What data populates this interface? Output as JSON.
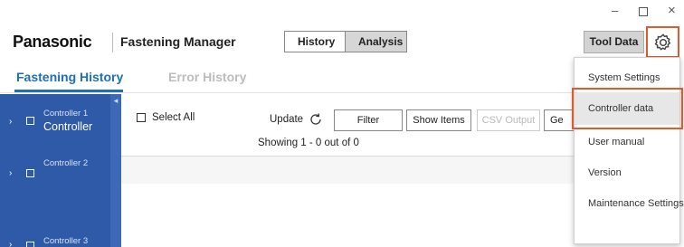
{
  "window": {
    "minimize_glyph": "–",
    "close_glyph": "×"
  },
  "header": {
    "brand": "Panasonic",
    "app_title": "Fastening Manager",
    "segments": [
      "History",
      "Analysis"
    ],
    "tool_data_label": "Tool Data",
    "settings_icon": "gear-icon"
  },
  "tabs": {
    "fastening_history": "Fastening History",
    "error_history": "Error History"
  },
  "sidebar": {
    "items": [
      {
        "title": "Controller 1",
        "subtitle": "Controller"
      },
      {
        "title": "Controller 2",
        "subtitle": ""
      },
      {
        "title": "Controller 3",
        "subtitle": ""
      }
    ]
  },
  "toolbar": {
    "select_all": "Select All",
    "update": "Update",
    "filter": "Filter",
    "show_items": "Show Items",
    "csv_output": "CSV Output",
    "ge_partial": "Ge",
    "showing": "Showing 1 - 0 out of 0"
  },
  "menu": {
    "items": [
      "System Settings",
      "Controller data",
      "User manual",
      "Version",
      "Maintenance Settings"
    ]
  },
  "colors": {
    "accent_blue": "#1e6fb8",
    "sidebar_blue": "#2f5aa8",
    "highlight_orange": "#e05a2b"
  }
}
